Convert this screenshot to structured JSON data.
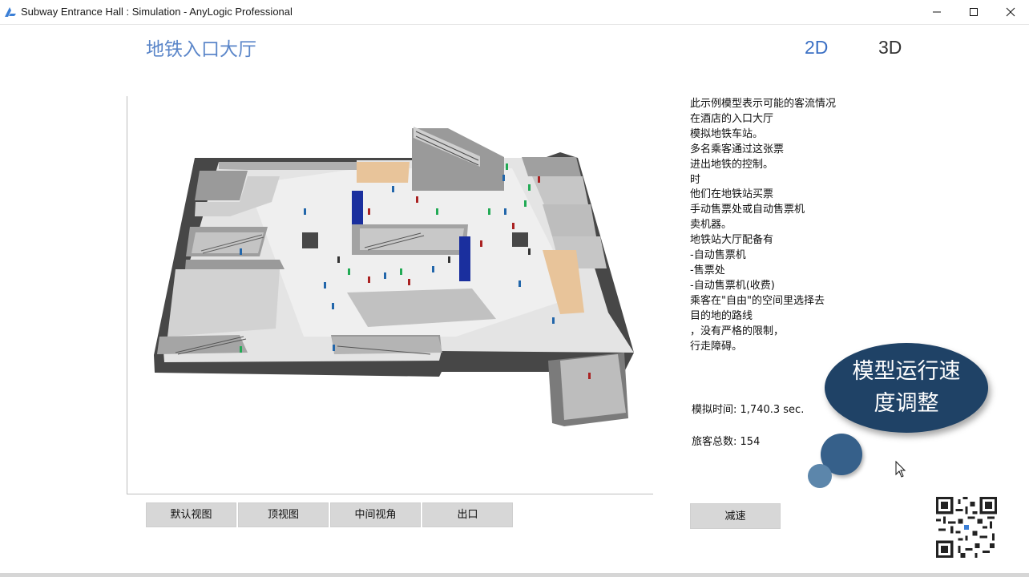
{
  "window": {
    "title": "Subway Entrance Hall : Simulation - AnyLogic Professional",
    "icon": "anylogic-logo-icon",
    "controls": [
      "minimize-icon",
      "maximize-icon",
      "close-icon"
    ]
  },
  "header": {
    "title": "地铁入口大厅",
    "tabs": [
      {
        "label": "2D",
        "color": "#3a6fc4"
      },
      {
        "label": "3D",
        "color": "#333333"
      }
    ]
  },
  "view_buttons": [
    {
      "label": "默认视图"
    },
    {
      "label": "顶视图"
    },
    {
      "label": "中间视角"
    },
    {
      "label": "出口"
    }
  ],
  "description": [
    "此示例模型表示可能的客流情况",
    "在酒店的入口大厅",
    "模拟地铁车站。",
    "多名乘客通过这张票",
    "进出地铁的控制。",
    "时",
    "他们在地铁站买票",
    "手动售票处或自动售票机",
    "卖机器。",
    "地铁站大厅配备有",
    "-自动售票机",
    "-售票处",
    "-自动售票机(收费)",
    "乘客在\"自由\"的空间里选择去",
    "目的地的路线",
    "，没有严格的限制，",
    "行走障碍。"
  ],
  "stats": {
    "time_label": "模拟时间:",
    "time_value": "1,740.3 sec.",
    "count_label": "旅客总数:",
    "count_value": "154"
  },
  "overlay": {
    "bubble_text": "模型运行速度调整",
    "bubble_color": "#1f4266"
  },
  "controls": {
    "slow_down_label": "减速"
  },
  "colors": {
    "title_blue": "#5b86c9",
    "accent_blue": "#3a6fc4",
    "floor": "#e8e8e8",
    "wall": "#8c8c8c",
    "turnstile": "#1a2f9e",
    "counter": "#e8c49a"
  }
}
